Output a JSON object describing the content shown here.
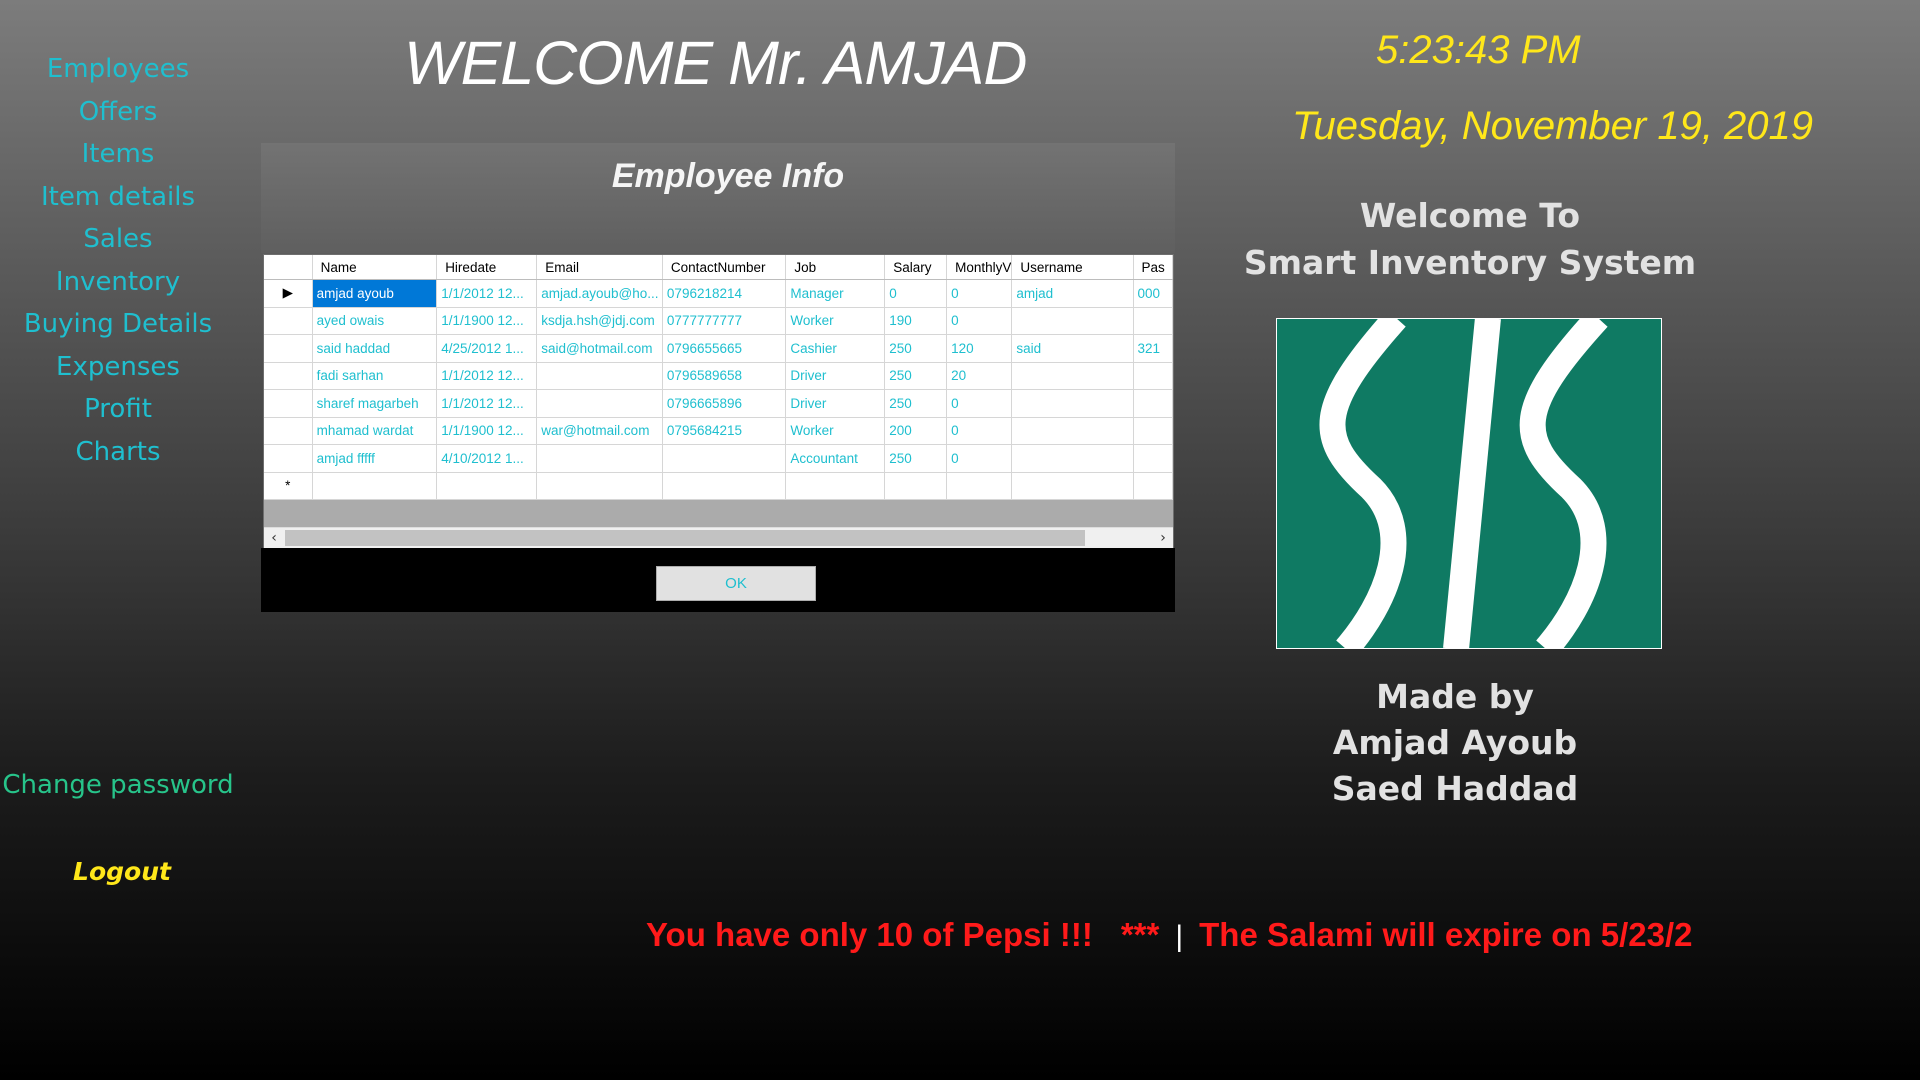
{
  "sidebar": {
    "items": [
      {
        "label": "Employees"
      },
      {
        "label": "Offers"
      },
      {
        "label": "Items"
      },
      {
        "label": "Item details"
      },
      {
        "label": "Sales"
      },
      {
        "label": "Inventory"
      },
      {
        "label": "Buying Details"
      },
      {
        "label": "Expenses"
      },
      {
        "label": "Profit"
      },
      {
        "label": "Charts"
      }
    ],
    "change_password": "Change password",
    "logout": "Logout"
  },
  "header": {
    "welcome": "WELCOME Mr. AMJAD",
    "time": "5:23:43 PM",
    "date": "Tuesday, November 19, 2019"
  },
  "about": {
    "welcome_line1": "Welcome To",
    "welcome_line2": "Smart Inventory System",
    "made_by": "Made by",
    "author1": "Amjad Ayoub",
    "author2": "Saed Haddad",
    "logo_color": "#0f7a63"
  },
  "employee_panel": {
    "title": "Employee Info",
    "ok_label": "OK",
    "columns": [
      "Name",
      "Hiredate",
      "Email",
      "ContactNumber",
      "Job",
      "Salary",
      "MonthlyV",
      "Username",
      "Pas"
    ],
    "rows": [
      {
        "marker": "▶",
        "cells": [
          "amjad ayoub",
          "1/1/2012 12...",
          "amjad.ayoub@ho...",
          "0796218214",
          "Manager",
          "0",
          "0",
          "amjad",
          "000"
        ]
      },
      {
        "marker": "",
        "cells": [
          "ayed owais",
          "1/1/1900 12...",
          "ksdja.hsh@jdj.com",
          "0777777777",
          "Worker",
          "190",
          "0",
          "",
          ""
        ]
      },
      {
        "marker": "",
        "cells": [
          "said haddad",
          "4/25/2012 1...",
          "said@hotmail.com",
          "0796655665",
          "Cashier",
          "250",
          "120",
          "said",
          "321"
        ]
      },
      {
        "marker": "",
        "cells": [
          "fadi sarhan",
          "1/1/2012 12...",
          "",
          "0796589658",
          "Driver",
          "250",
          "20",
          "",
          ""
        ]
      },
      {
        "marker": "",
        "cells": [
          "sharef magarbeh",
          "1/1/2012 12...",
          "",
          "0796665896",
          "Driver",
          "250",
          "0",
          "",
          ""
        ]
      },
      {
        "marker": "",
        "cells": [
          "mhamad wardat",
          "1/1/1900 12...",
          "war@hotmail.com",
          "0795684215",
          "Worker",
          "200",
          "0",
          "",
          ""
        ]
      },
      {
        "marker": "",
        "cells": [
          "amjad fffff",
          "4/10/2012 1...",
          "",
          "",
          "Accountant",
          "250",
          "0",
          "",
          ""
        ]
      },
      {
        "marker": "*",
        "cells": [
          "",
          "",
          "",
          "",
          "",
          "",
          "",
          "",
          ""
        ]
      }
    ]
  },
  "ticker": {
    "msg1": "You have only 10 of Pepsi !!!",
    "stars": "***",
    "sep": "|",
    "msg2": "The Salami will expire on 5/23/2"
  }
}
